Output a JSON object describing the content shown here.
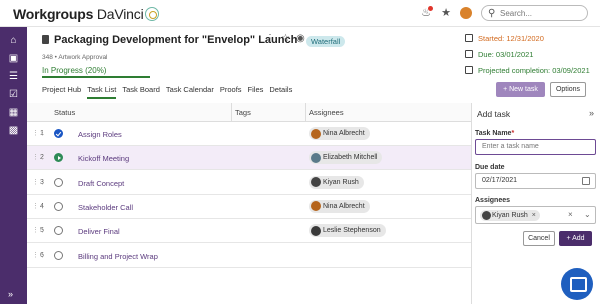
{
  "app": {
    "name_bold": "Workgroups",
    "name_rest": " DaVinci"
  },
  "topbar": {
    "search_placeholder": "Search..."
  },
  "project": {
    "title": "Packaging Development for \"Envelop\" Launch",
    "methodology": "Waterfall",
    "subtitle": "348 • Artwork Approval",
    "status_text": "In Progress  (20%)",
    "progress": 0.2,
    "started": "Started: 12/31/2020",
    "due": "Due: 03/01/2021",
    "projected": "Projected completion: 03/09/2021"
  },
  "tabs": [
    "Project Hub",
    "Task List",
    "Task Board",
    "Task Calendar",
    "Proofs",
    "Files",
    "Details"
  ],
  "actions": {
    "new_task": "+ New task",
    "options": "Options"
  },
  "table": {
    "columns": [
      "Status",
      "Tags",
      "Assignees"
    ],
    "rows": [
      {
        "num": "1",
        "name": "Assign Roles",
        "assignee": "Nina Albrecht",
        "status": "done",
        "avatar": "#b5651d"
      },
      {
        "num": "2",
        "name": "Kickoff Meeting",
        "assignee": "Elizabeth Mitchell",
        "status": "play",
        "avatar": "#5a7a8a"
      },
      {
        "num": "3",
        "name": "Draft Concept",
        "assignee": "Kiyan Rush",
        "status": "open",
        "avatar": "#444444"
      },
      {
        "num": "4",
        "name": "Stakeholder Call",
        "assignee": "Nina Albrecht",
        "status": "open",
        "avatar": "#b5651d"
      },
      {
        "num": "5",
        "name": "Deliver Final",
        "assignee": "Leslie Stephenson",
        "status": "open",
        "avatar": "#3a3a3a"
      },
      {
        "num": "6",
        "name": "Billing and Project Wrap",
        "assignee": "",
        "status": "open",
        "avatar": ""
      }
    ]
  },
  "panel": {
    "title": "Add task",
    "task_name_label": "Task Name",
    "required_mark": "*",
    "task_name_placeholder": "Enter a task name",
    "due_label": "Due date",
    "due_value": "02/17/2021",
    "assignees_label": "Assignees",
    "assignee_chip": "Kiyan Rush",
    "cancel": "Cancel",
    "add": "+ Add"
  }
}
